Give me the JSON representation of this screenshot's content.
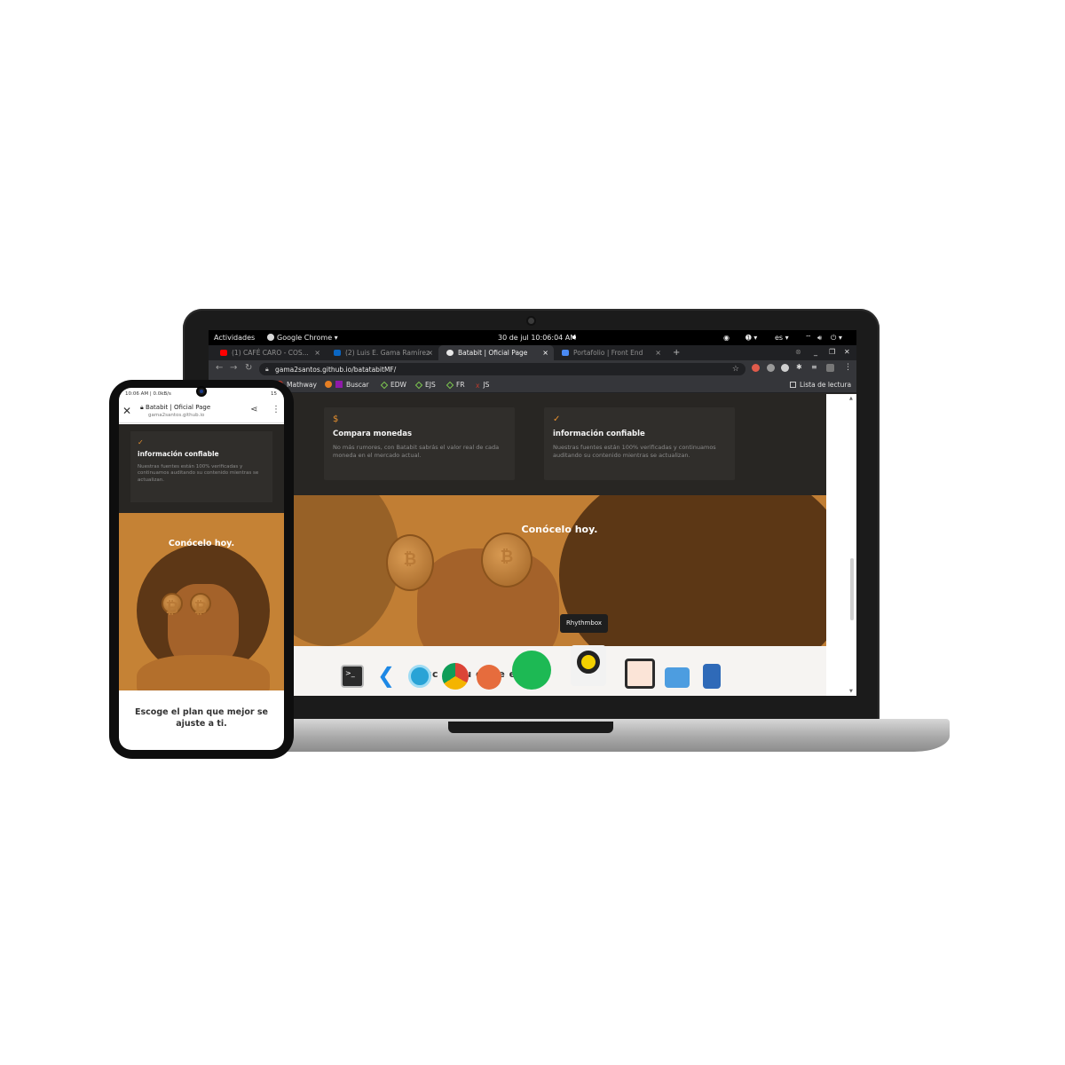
{
  "os_bar": {
    "activities": "Actividades",
    "app_name": "Google Chrome ▾",
    "datetime": "30 de jul  10:06:04 AM",
    "lang": "es ▾"
  },
  "browser": {
    "tabs": [
      {
        "label": "(1) CAFÉ CARO - COS...",
        "favicon_color": "#ff0000",
        "active": false
      },
      {
        "label": "(2) Luis E. Gama Ramírez",
        "favicon_color": "#0a66c2",
        "active": false
      },
      {
        "label": "Batabit | Oficial Page",
        "favicon_color": "#e8e8e8",
        "active": true
      },
      {
        "label": "Portafolio | Front End",
        "favicon_color": "#4a8af4",
        "active": false
      }
    ],
    "url": "gama2santos.github.io/batatabitMF/",
    "bookmarks": [
      {
        "label": "Mathway",
        "color": "#c0392b"
      },
      {
        "label": "Buscar",
        "color": "#e67e22"
      },
      {
        "label": "EDW",
        "color": "#7ec850"
      },
      {
        "label": "EJS",
        "color": "#7ec850"
      },
      {
        "label": "FR",
        "color": "#7ec850"
      },
      {
        "label": "JS",
        "color": "#c0392b"
      }
    ],
    "reading_list": "Lista de lectura"
  },
  "site": {
    "card1": {
      "icon": "$",
      "title": "Compara monedas",
      "text": "No más rumores, con Batabit sabrás el valor real de cada moneda en el mercado actual."
    },
    "card2": {
      "icon": "✓",
      "title": "información confiable",
      "text": "Nuestras fuentes están 100% verificadas y continuamos auditando su contenido mientras se actualizan."
    },
    "hero_title": "Conócelo hoy.",
    "partial_heading": "sc   el    qu    or se      e a"
  },
  "dock": {
    "tooltip": "Rhythmbox",
    "apps": [
      "terminal-icon",
      "vscode-icon",
      "settings-icon",
      "chrome-icon",
      "firefox-icon",
      "spotify-icon",
      "rhythmbox-icon",
      "image-viewer-icon",
      "files-icon",
      "text-editor-icon"
    ]
  },
  "phone": {
    "status_left": "10:06 AM | 0.0kB/s",
    "status_right": "15",
    "tab_title": "Batabit | Oficial Page",
    "url": "gama2santos.github.io",
    "card": {
      "icon": "✓",
      "title": "información confiable",
      "text": "Nuestras fuentes están 100% verificadas y continuamos auditando su contenido mientras se actualizan."
    },
    "hero_title": "Conócelo hoy.",
    "plan_text": "Escoge el plan que mejor se ajuste a ti."
  },
  "colors": {
    "accent": "#e8912f",
    "hero_bg": "#c17e34",
    "page_dark": "#282623"
  }
}
